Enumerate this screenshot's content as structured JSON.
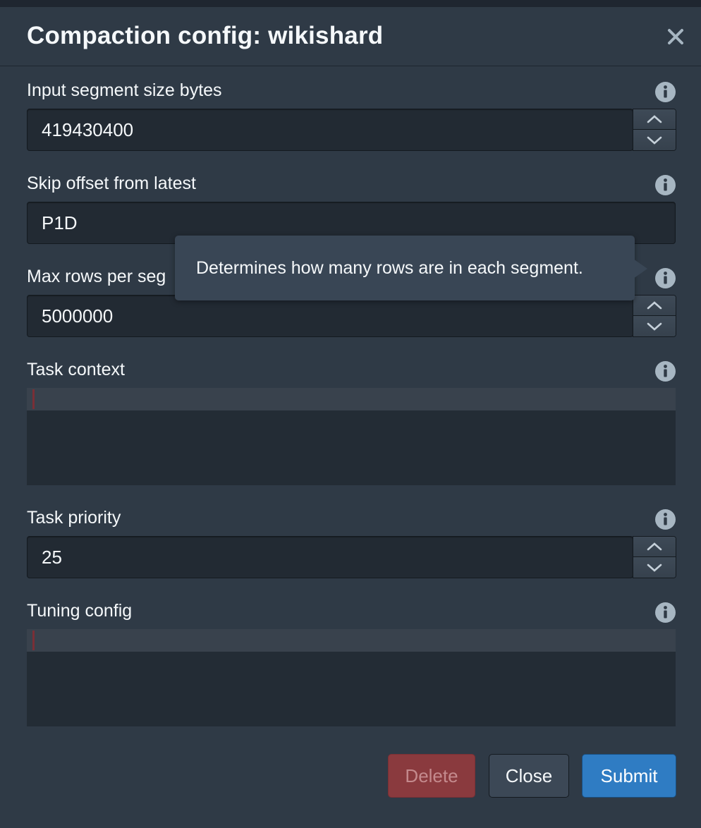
{
  "dialog": {
    "title": "Compaction config: wikishard"
  },
  "fields": {
    "input_segment_size": {
      "label": "Input segment size bytes",
      "value": "419430400"
    },
    "skip_offset": {
      "label": "Skip offset from latest",
      "value": "P1D"
    },
    "max_rows": {
      "label": "Max rows per seg",
      "value": "5000000"
    },
    "task_context": {
      "label": "Task context"
    },
    "task_priority": {
      "label": "Task priority",
      "value": "25"
    },
    "tuning_config": {
      "label": "Tuning config"
    }
  },
  "tooltip": {
    "text": "Determines how many rows are in each segment."
  },
  "buttons": {
    "delete": "Delete",
    "close": "Close",
    "submit": "Submit"
  },
  "icons": {
    "info": "info-icon",
    "close": "close-icon",
    "chevron_up": "chevron-up-icon",
    "chevron_down": "chevron-down-icon"
  },
  "colors": {
    "dialog_bg": "#2f3a46",
    "input_bg": "#222a33",
    "submit": "#2f7cc3",
    "delete": "#8a3a3e"
  }
}
